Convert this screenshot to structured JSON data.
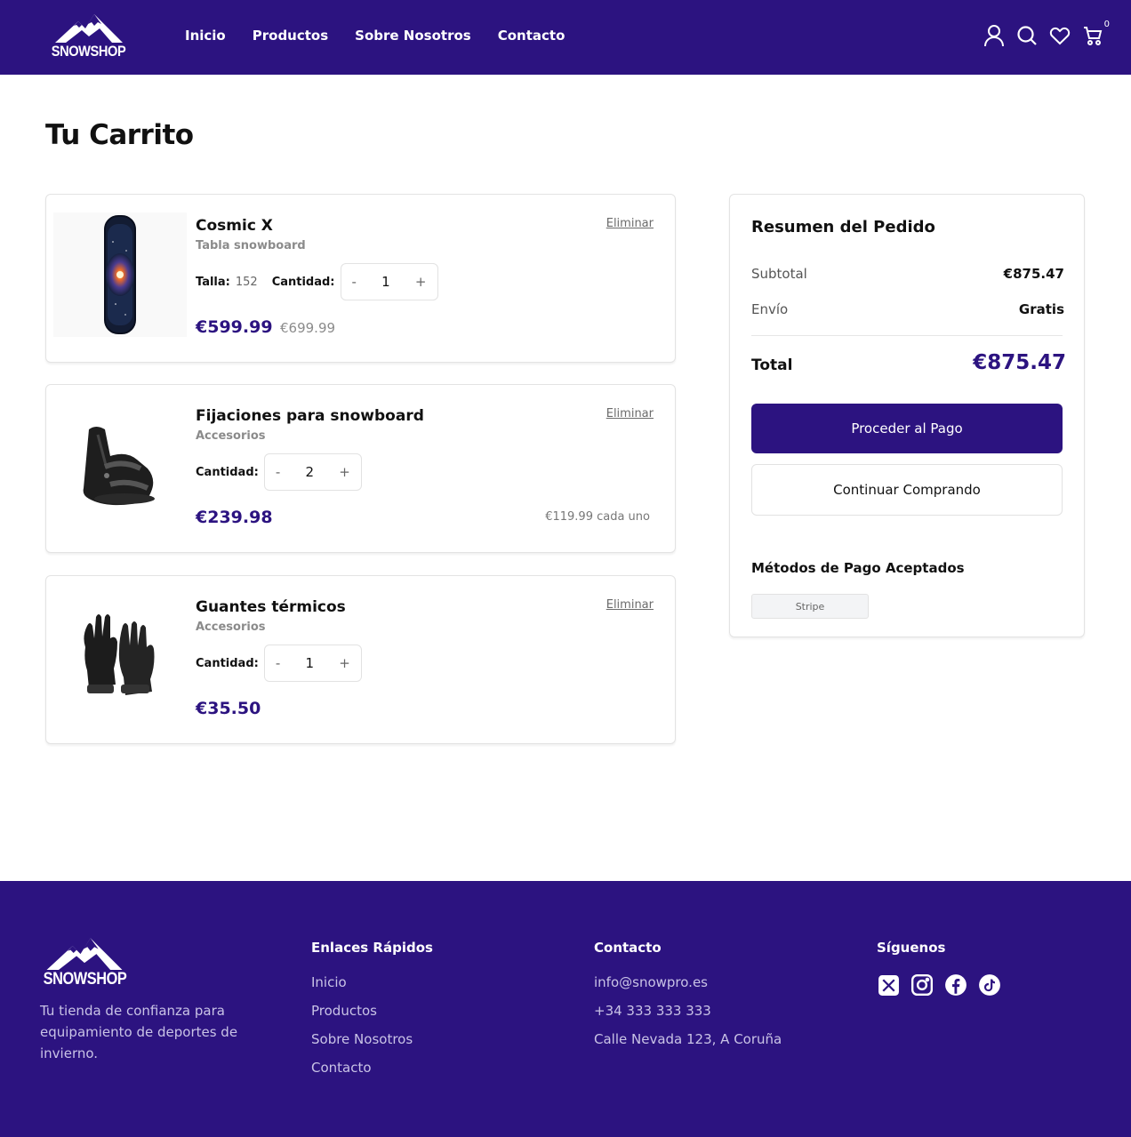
{
  "brand": {
    "name": "SNOWSHOP",
    "primary_color": "#2c1380"
  },
  "nav": {
    "items": [
      "Inicio",
      "Productos",
      "Sobre Nosotros",
      "Contacto"
    ]
  },
  "header_icons": {
    "user": "user-icon",
    "search": "search-icon",
    "wishlist": "heart-icon",
    "cart": "cart-icon",
    "cart_count": "0"
  },
  "page": {
    "title": "Tu Carrito"
  },
  "cart": {
    "remove_label": "Eliminar",
    "quantity_label": "Cantidad:",
    "size_label": "Talla:",
    "items": [
      {
        "name": "Cosmic X",
        "category": "Tabla snowboard",
        "size": "152",
        "quantity": "1",
        "price": "€599.99",
        "old_price": "€699.99",
        "image": "snowboard-image"
      },
      {
        "name": "Fijaciones para snowboard",
        "category": "Accesorios",
        "quantity": "2",
        "price": "€239.98",
        "each_price": "€119.99 cada uno",
        "image": "bindings-image"
      },
      {
        "name": "Guantes térmicos",
        "category": "Accesorios",
        "quantity": "1",
        "price": "€35.50",
        "image": "gloves-image"
      }
    ]
  },
  "summary": {
    "title": "Resumen del Pedido",
    "subtotal_label": "Subtotal",
    "subtotal_value": "€875.47",
    "shipping_label": "Envío",
    "shipping_value": "Gratis",
    "total_label": "Total",
    "total_value": "€875.47",
    "checkout_label": "Proceder al Pago",
    "continue_label": "Continuar Comprando",
    "payment_title": "Métodos de Pago Aceptados",
    "payment_methods": [
      "Stripe"
    ]
  },
  "footer": {
    "tagline": "Tu tienda de confianza para equipamiento de deportes de invierno.",
    "links_title": "Enlaces Rápidos",
    "links": [
      "Inicio",
      "Productos",
      "Sobre Nosotros",
      "Contacto"
    ],
    "contact_title": "Contacto",
    "contact": [
      "info@snowpro.es",
      "+34 333 333 333",
      "Calle Nevada 123, A Coruña"
    ],
    "social_title": "Síguenos",
    "socials": [
      "x-icon",
      "instagram-icon",
      "facebook-icon",
      "tiktok-icon"
    ]
  }
}
